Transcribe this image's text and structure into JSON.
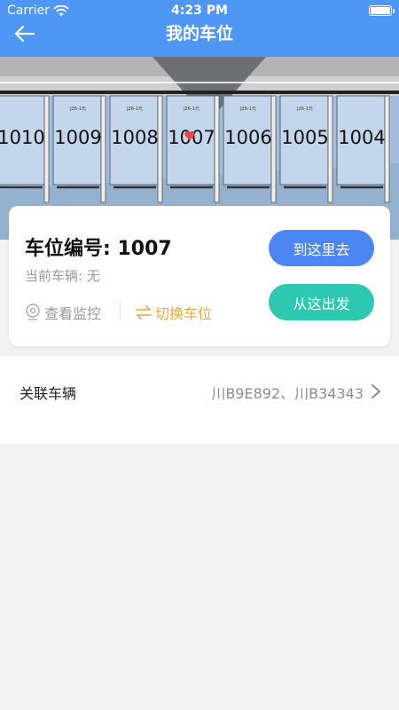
{
  "status": {
    "carrier": "Carrier",
    "time": "4:23 PM",
    "battery_level": 1.0
  },
  "header": {
    "title": "我的车位"
  },
  "map": {
    "spots": [
      "1010",
      "1009",
      "1008",
      "1007",
      "1006",
      "1005",
      "1004"
    ],
    "selected": "1007",
    "small_labels": [
      "J26-1元",
      "J26-1元",
      "J26-1元",
      "J26-1元",
      "J26-1元"
    ]
  },
  "card": {
    "spot_title": "车位编号: 1007",
    "vehicle": "当前车辆: 无",
    "monitor_label": "查看监控",
    "switch_label": "切换车位",
    "go_here": "到这里去",
    "start_here": "从这出发"
  },
  "related": {
    "label": "关联车辆",
    "value": "川B9E892、川B34343"
  },
  "colors": {
    "header": "#4f97f5",
    "go": "#4c86f5",
    "start": "#2cc8b0",
    "switch": "#f3a531",
    "pin": "#e64545"
  }
}
